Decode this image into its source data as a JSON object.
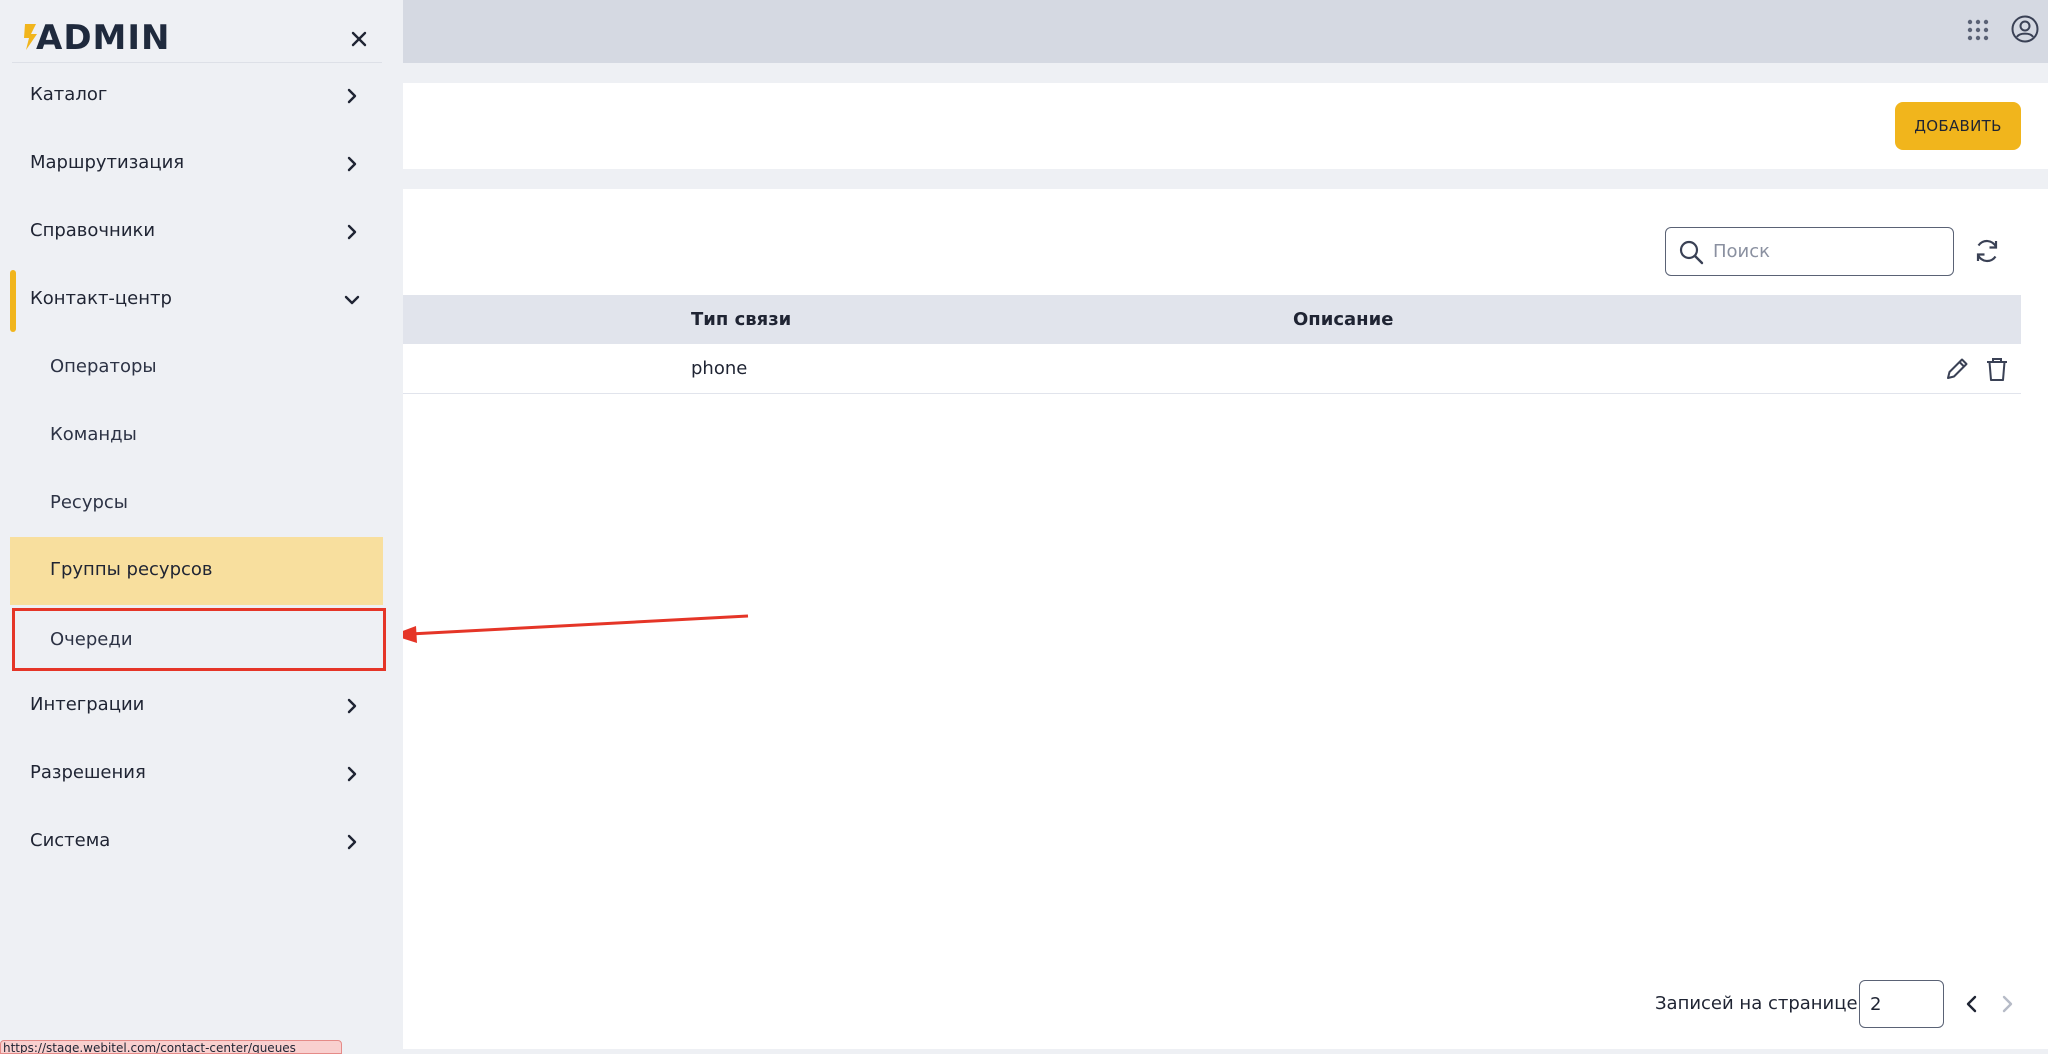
{
  "app": {
    "logo_text": "ADMIN"
  },
  "sidebar": {
    "items": [
      {
        "label": "Каталог"
      },
      {
        "label": "Маршрутизация"
      },
      {
        "label": "Справочники"
      },
      {
        "label": "Контакт-центр"
      },
      {
        "label": "Интеграции"
      },
      {
        "label": "Разрешения"
      },
      {
        "label": "Система"
      }
    ],
    "sub_items": [
      {
        "label": "Операторы"
      },
      {
        "label": "Команды"
      },
      {
        "label": "Ресурсы"
      },
      {
        "label": "Группы ресурсов"
      },
      {
        "label": "Очереди"
      }
    ]
  },
  "header": {
    "add_label": "ДОБАВИТЬ"
  },
  "search": {
    "placeholder": "Поиск"
  },
  "table": {
    "columns": [
      "Тип связи",
      "Описание"
    ],
    "rows": [
      {
        "type": "phone",
        "description": ""
      }
    ]
  },
  "pagination": {
    "per_page_label": "Записей на странице:",
    "per_page_value": "2"
  },
  "status_url": "https://stage.webitel.com/contact-center/queues",
  "colors": {
    "accent": "#f1b51c",
    "selected": "#f8df9e",
    "annotation": "#e53527"
  }
}
